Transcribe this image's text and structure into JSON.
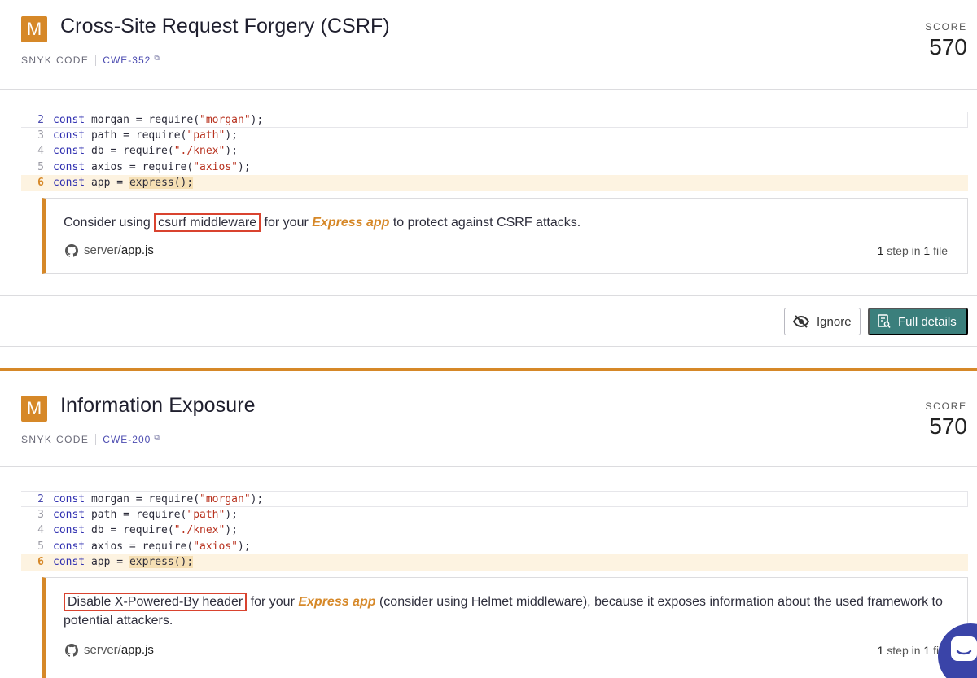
{
  "issues": [
    {
      "severity": "M",
      "title": "Cross-Site Request Forgery (CSRF)",
      "source": "SNYK CODE",
      "cwe": "CWE-352",
      "score_label": "SCORE",
      "score": "570",
      "message": {
        "highlight": "csurf middleware",
        "before": "Consider using ",
        "middle": " for your ",
        "framework": "Express app",
        "after": " to protect against CSRF attacks."
      },
      "file": {
        "dir": "server/",
        "name": "app.js"
      },
      "steps": {
        "count": "1",
        "mid": " step in ",
        "files": "1",
        "tail": " file"
      }
    },
    {
      "severity": "M",
      "title": "Information Exposure",
      "source": "SNYK CODE",
      "cwe": "CWE-200",
      "score_label": "SCORE",
      "score": "570",
      "message": {
        "highlight": "Disable X-Powered-By header",
        "before": "",
        "middle": " for your ",
        "framework": "Express app",
        "after": " (consider using Helmet middleware), because it exposes information about the used framework to potential attackers."
      },
      "file": {
        "dir": "server/",
        "name": "app.js"
      },
      "steps": {
        "count": "1",
        "mid": " step in ",
        "files": "1",
        "tail": " file"
      }
    }
  ],
  "code": {
    "lines": [
      {
        "num": "2",
        "kw": "const",
        "rest": " morgan = require(",
        "str": "\"morgan\"",
        "end": ");"
      },
      {
        "num": "3",
        "kw": "const",
        "rest": " path = require(",
        "str": "\"path\"",
        "end": ");"
      },
      {
        "num": "4",
        "kw": "const",
        "rest": " db = require(",
        "str": "\"./knex\"",
        "end": ");"
      },
      {
        "num": "5",
        "kw": "const",
        "rest": " axios = require(",
        "str": "\"axios\"",
        "end": ");"
      },
      {
        "num": "6",
        "kw": "const",
        "rest": " app = ",
        "call": "express();",
        "end": ""
      }
    ]
  },
  "actions": {
    "ignore": "Ignore",
    "full_details": "Full details"
  },
  "colors": {
    "severity_medium": "#d68828",
    "primary_button": "#3b7f7c",
    "highlight_box": "#d9432f",
    "chat": "#3a44a8"
  },
  "icons": {
    "external": "external-link-icon",
    "github": "github-icon",
    "ignore": "eye-off-icon",
    "details": "document-search-icon",
    "chat": "chat-icon"
  }
}
